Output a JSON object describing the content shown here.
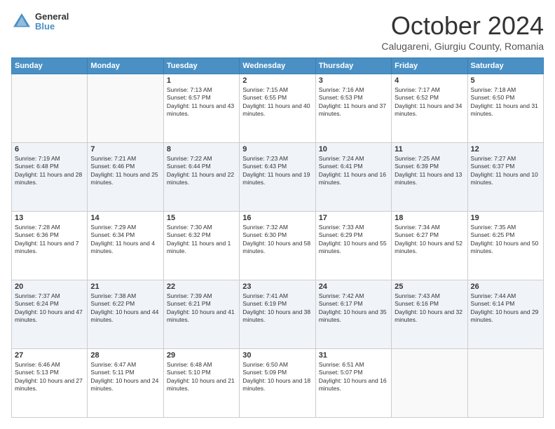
{
  "logo": {
    "general": "General",
    "blue": "Blue"
  },
  "header": {
    "month": "October 2024",
    "location": "Calugareni, Giurgiu County, Romania"
  },
  "days_of_week": [
    "Sunday",
    "Monday",
    "Tuesday",
    "Wednesday",
    "Thursday",
    "Friday",
    "Saturday"
  ],
  "weeks": [
    {
      "cells": [
        {
          "day": "",
          "sunrise": "",
          "sunset": "",
          "daylight": ""
        },
        {
          "day": "",
          "sunrise": "",
          "sunset": "",
          "daylight": ""
        },
        {
          "day": "1",
          "sunrise": "Sunrise: 7:13 AM",
          "sunset": "Sunset: 6:57 PM",
          "daylight": "Daylight: 11 hours and 43 minutes."
        },
        {
          "day": "2",
          "sunrise": "Sunrise: 7:15 AM",
          "sunset": "Sunset: 6:55 PM",
          "daylight": "Daylight: 11 hours and 40 minutes."
        },
        {
          "day": "3",
          "sunrise": "Sunrise: 7:16 AM",
          "sunset": "Sunset: 6:53 PM",
          "daylight": "Daylight: 11 hours and 37 minutes."
        },
        {
          "day": "4",
          "sunrise": "Sunrise: 7:17 AM",
          "sunset": "Sunset: 6:52 PM",
          "daylight": "Daylight: 11 hours and 34 minutes."
        },
        {
          "day": "5",
          "sunrise": "Sunrise: 7:18 AM",
          "sunset": "Sunset: 6:50 PM",
          "daylight": "Daylight: 11 hours and 31 minutes."
        }
      ]
    },
    {
      "cells": [
        {
          "day": "6",
          "sunrise": "Sunrise: 7:19 AM",
          "sunset": "Sunset: 6:48 PM",
          "daylight": "Daylight: 11 hours and 28 minutes."
        },
        {
          "day": "7",
          "sunrise": "Sunrise: 7:21 AM",
          "sunset": "Sunset: 6:46 PM",
          "daylight": "Daylight: 11 hours and 25 minutes."
        },
        {
          "day": "8",
          "sunrise": "Sunrise: 7:22 AM",
          "sunset": "Sunset: 6:44 PM",
          "daylight": "Daylight: 11 hours and 22 minutes."
        },
        {
          "day": "9",
          "sunrise": "Sunrise: 7:23 AM",
          "sunset": "Sunset: 6:43 PM",
          "daylight": "Daylight: 11 hours and 19 minutes."
        },
        {
          "day": "10",
          "sunrise": "Sunrise: 7:24 AM",
          "sunset": "Sunset: 6:41 PM",
          "daylight": "Daylight: 11 hours and 16 minutes."
        },
        {
          "day": "11",
          "sunrise": "Sunrise: 7:25 AM",
          "sunset": "Sunset: 6:39 PM",
          "daylight": "Daylight: 11 hours and 13 minutes."
        },
        {
          "day": "12",
          "sunrise": "Sunrise: 7:27 AM",
          "sunset": "Sunset: 6:37 PM",
          "daylight": "Daylight: 11 hours and 10 minutes."
        }
      ]
    },
    {
      "cells": [
        {
          "day": "13",
          "sunrise": "Sunrise: 7:28 AM",
          "sunset": "Sunset: 6:36 PM",
          "daylight": "Daylight: 11 hours and 7 minutes."
        },
        {
          "day": "14",
          "sunrise": "Sunrise: 7:29 AM",
          "sunset": "Sunset: 6:34 PM",
          "daylight": "Daylight: 11 hours and 4 minutes."
        },
        {
          "day": "15",
          "sunrise": "Sunrise: 7:30 AM",
          "sunset": "Sunset: 6:32 PM",
          "daylight": "Daylight: 11 hours and 1 minute."
        },
        {
          "day": "16",
          "sunrise": "Sunrise: 7:32 AM",
          "sunset": "Sunset: 6:30 PM",
          "daylight": "Daylight: 10 hours and 58 minutes."
        },
        {
          "day": "17",
          "sunrise": "Sunrise: 7:33 AM",
          "sunset": "Sunset: 6:29 PM",
          "daylight": "Daylight: 10 hours and 55 minutes."
        },
        {
          "day": "18",
          "sunrise": "Sunrise: 7:34 AM",
          "sunset": "Sunset: 6:27 PM",
          "daylight": "Daylight: 10 hours and 52 minutes."
        },
        {
          "day": "19",
          "sunrise": "Sunrise: 7:35 AM",
          "sunset": "Sunset: 6:25 PM",
          "daylight": "Daylight: 10 hours and 50 minutes."
        }
      ]
    },
    {
      "cells": [
        {
          "day": "20",
          "sunrise": "Sunrise: 7:37 AM",
          "sunset": "Sunset: 6:24 PM",
          "daylight": "Daylight: 10 hours and 47 minutes."
        },
        {
          "day": "21",
          "sunrise": "Sunrise: 7:38 AM",
          "sunset": "Sunset: 6:22 PM",
          "daylight": "Daylight: 10 hours and 44 minutes."
        },
        {
          "day": "22",
          "sunrise": "Sunrise: 7:39 AM",
          "sunset": "Sunset: 6:21 PM",
          "daylight": "Daylight: 10 hours and 41 minutes."
        },
        {
          "day": "23",
          "sunrise": "Sunrise: 7:41 AM",
          "sunset": "Sunset: 6:19 PM",
          "daylight": "Daylight: 10 hours and 38 minutes."
        },
        {
          "day": "24",
          "sunrise": "Sunrise: 7:42 AM",
          "sunset": "Sunset: 6:17 PM",
          "daylight": "Daylight: 10 hours and 35 minutes."
        },
        {
          "day": "25",
          "sunrise": "Sunrise: 7:43 AM",
          "sunset": "Sunset: 6:16 PM",
          "daylight": "Daylight: 10 hours and 32 minutes."
        },
        {
          "day": "26",
          "sunrise": "Sunrise: 7:44 AM",
          "sunset": "Sunset: 6:14 PM",
          "daylight": "Daylight: 10 hours and 29 minutes."
        }
      ]
    },
    {
      "cells": [
        {
          "day": "27",
          "sunrise": "Sunrise: 6:46 AM",
          "sunset": "Sunset: 5:13 PM",
          "daylight": "Daylight: 10 hours and 27 minutes."
        },
        {
          "day": "28",
          "sunrise": "Sunrise: 6:47 AM",
          "sunset": "Sunset: 5:11 PM",
          "daylight": "Daylight: 10 hours and 24 minutes."
        },
        {
          "day": "29",
          "sunrise": "Sunrise: 6:48 AM",
          "sunset": "Sunset: 5:10 PM",
          "daylight": "Daylight: 10 hours and 21 minutes."
        },
        {
          "day": "30",
          "sunrise": "Sunrise: 6:50 AM",
          "sunset": "Sunset: 5:09 PM",
          "daylight": "Daylight: 10 hours and 18 minutes."
        },
        {
          "day": "31",
          "sunrise": "Sunrise: 6:51 AM",
          "sunset": "Sunset: 5:07 PM",
          "daylight": "Daylight: 10 hours and 16 minutes."
        },
        {
          "day": "",
          "sunrise": "",
          "sunset": "",
          "daylight": ""
        },
        {
          "day": "",
          "sunrise": "",
          "sunset": "",
          "daylight": ""
        }
      ]
    }
  ]
}
